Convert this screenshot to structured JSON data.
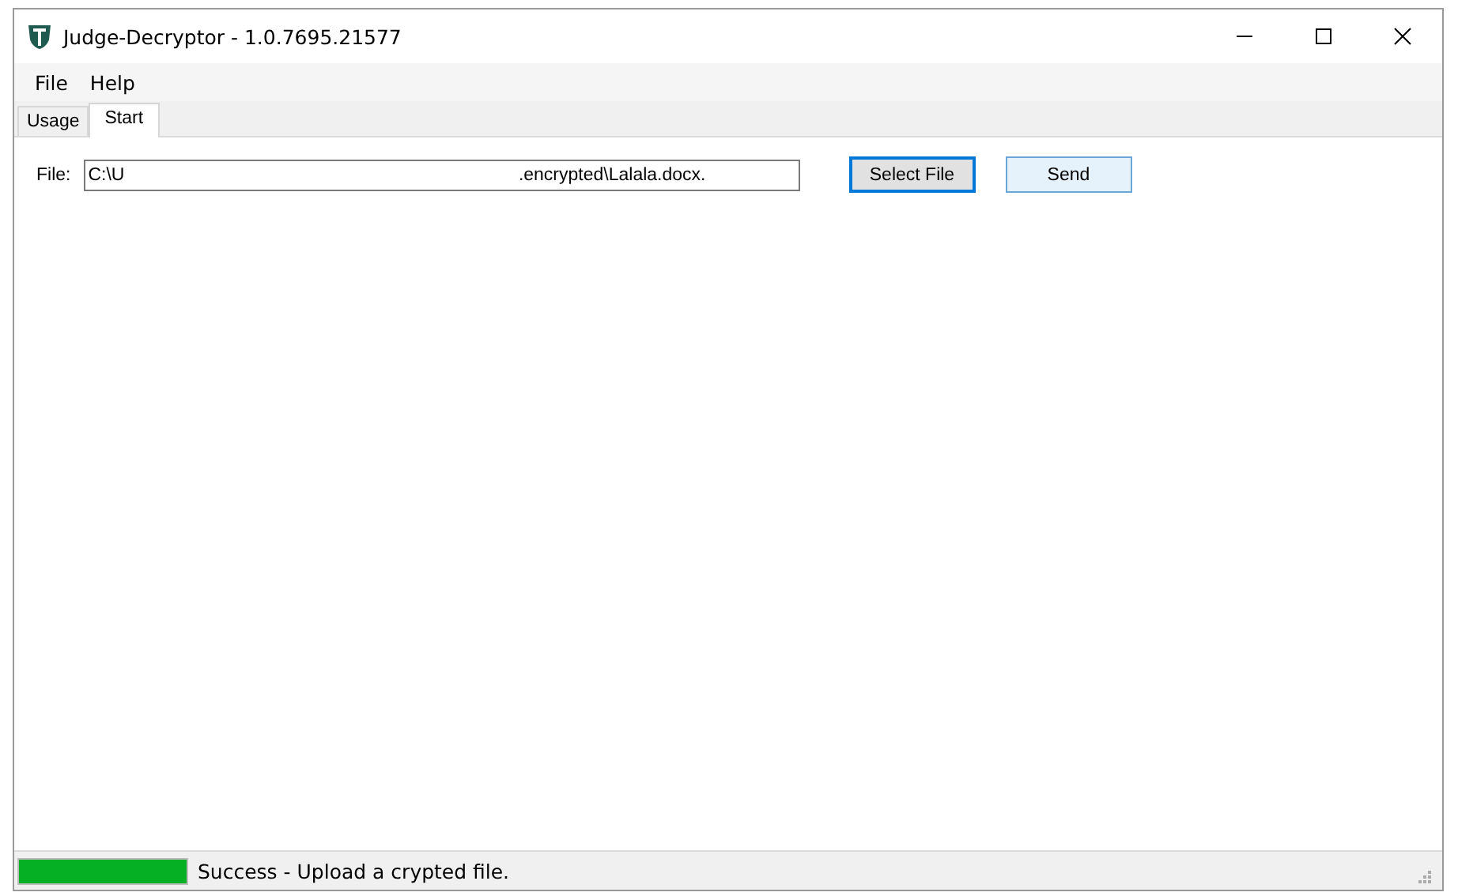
{
  "window": {
    "title": "Judge-Decryptor - 1.0.7695.21577"
  },
  "menu": [
    "File",
    "Help"
  ],
  "tabs": [
    {
      "label": "Usage",
      "selected": false
    },
    {
      "label": "Start",
      "selected": true
    }
  ],
  "file_row": {
    "label": "File:",
    "value": "C:\\U                                                                              .encrypted\\Lalala.docx."
  },
  "buttons": [
    {
      "label": "Select File",
      "focused": true
    },
    {
      "label": "Send",
      "focused": false
    }
  ],
  "status_bar": {
    "progress": {
      "level": 1
    },
    "message": "Success - Upload a crypted file."
  }
}
